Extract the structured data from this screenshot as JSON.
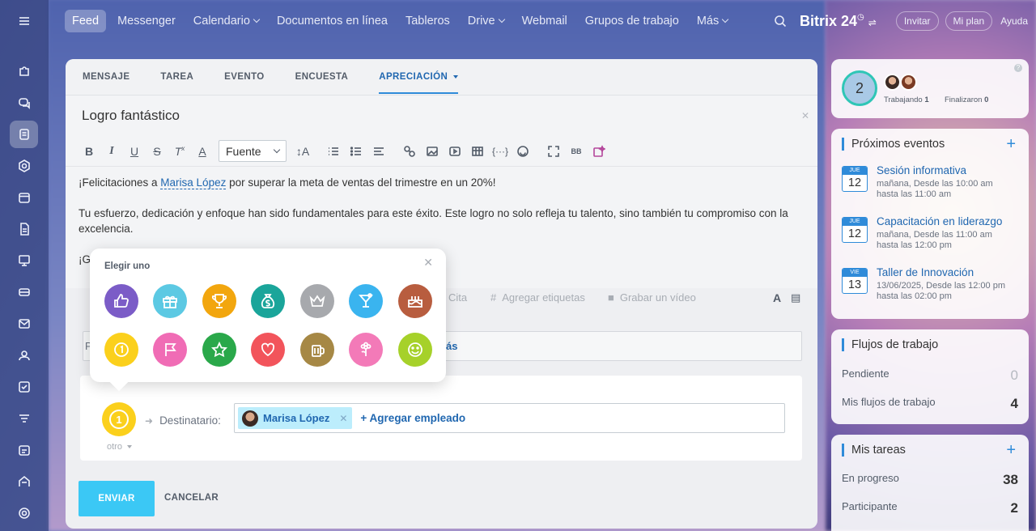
{
  "sidebar": {
    "icons": [
      "puzzle-icon",
      "chat-icon",
      "feed-icon",
      "hexagon-icon",
      "calendar-icon",
      "document-icon",
      "board-icon",
      "card-icon",
      "mail-icon",
      "group-icon",
      "task-icon",
      "funnel-icon",
      "schedule-icon",
      "store-icon",
      "gear-icon"
    ]
  },
  "topbar": {
    "nav": [
      {
        "label": "Feed",
        "active": true
      },
      {
        "label": "Messenger"
      },
      {
        "label": "Calendario",
        "dropdown": true
      },
      {
        "label": "Documentos en línea"
      },
      {
        "label": "Tableros"
      },
      {
        "label": "Drive",
        "dropdown": true
      },
      {
        "label": "Webmail"
      },
      {
        "label": "Grupos de trabajo"
      },
      {
        "label": "Más",
        "dropdown": true
      }
    ],
    "brand": "Bitrix 24",
    "invite": "Invitar",
    "plan": "Mi plan",
    "help": "Ayuda"
  },
  "composer": {
    "tabs": [
      "MENSAJE",
      "TAREA",
      "EVENTO",
      "ENCUESTA",
      "APRECIACIÓN"
    ],
    "active_tab": "APRECIACIÓN",
    "title": "Logro fantástico",
    "font_select": "Fuente",
    "body": {
      "line1_pre": "¡Felicitaciones a ",
      "mention": "Marisa López",
      "line1_post": " por superar la meta de ventas del trimestre en un 20%!",
      "line2": "Tu esfuerzo, dedicación y enfoque han sido fundamentales para este éxito. Este logro no solo refleja tu talento, sino también tu compromiso con la excelencia.",
      "line3_fragment": "¡G"
    },
    "bottom_tools": {
      "quote": "Cita",
      "tags": "Agregar etiquetas",
      "video": "Grabar un vídeo"
    },
    "recipient_field_prefix": "P",
    "recipient_field_suffix": "ás",
    "gratitude": {
      "medal_label": "1",
      "type_label": "otro",
      "recipient_label": "Destinatario:",
      "recipient_name": "Marisa López",
      "add_employee": "+ Agregar empleado"
    },
    "send": "ENVIAR",
    "cancel": "CANCELAR"
  },
  "popup": {
    "title": "Elegir uno",
    "badges": [
      {
        "name": "thumbs-up-icon",
        "color": "#7b5cc7"
      },
      {
        "name": "gift-icon",
        "color": "#5cc9e3"
      },
      {
        "name": "trophy-icon",
        "color": "#f2a60e"
      },
      {
        "name": "money-bag-icon",
        "color": "#1aa59a"
      },
      {
        "name": "crown-icon",
        "color": "#a7a9ad"
      },
      {
        "name": "cocktail-icon",
        "color": "#3ab4ef"
      },
      {
        "name": "cake-icon",
        "color": "#b85d3f"
      },
      {
        "name": "medal-icon",
        "color": "#fbd01c"
      },
      {
        "name": "flag-icon",
        "color": "#f06cb5"
      },
      {
        "name": "star-icon",
        "color": "#2aa84a"
      },
      {
        "name": "heart-icon",
        "color": "#f2545b"
      },
      {
        "name": "beer-icon",
        "color": "#a68845"
      },
      {
        "name": "flower-icon",
        "color": "#f37ab8"
      },
      {
        "name": "smile-icon",
        "color": "#a6d12a"
      }
    ]
  },
  "right": {
    "status": {
      "count": "2",
      "working_label": "Trabajando",
      "working_count": "1",
      "finished_label": "Finalizaron",
      "finished_count": "0"
    },
    "events": {
      "title": "Próximos eventos",
      "items": [
        {
          "month": "JUE",
          "day": "12",
          "title": "Sesión informativa",
          "line1": "mañana, Desde las 10:00 am",
          "line2": "hasta las 11:00 am"
        },
        {
          "month": "JUE",
          "day": "12",
          "title": "Capacitación en liderazgo",
          "line1": "mañana, Desde las 11:00 am",
          "line2": "hasta las 12:00 pm"
        },
        {
          "month": "VIE",
          "day": "13",
          "title": "Taller de Innovación",
          "line1": "13/06/2025, Desde las 12:00 pm",
          "line2": "hasta las 02:00 pm"
        }
      ]
    },
    "workflows": {
      "title": "Flujos de trabajo",
      "pending_label": "Pendiente",
      "pending_value": "0",
      "mine_label": "Mis flujos de trabajo",
      "mine_value": "4"
    },
    "tasks": {
      "title": "Mis tareas",
      "progress_label": "En progreso",
      "progress_value": "38",
      "participant_label": "Participante",
      "participant_value": "2"
    }
  }
}
